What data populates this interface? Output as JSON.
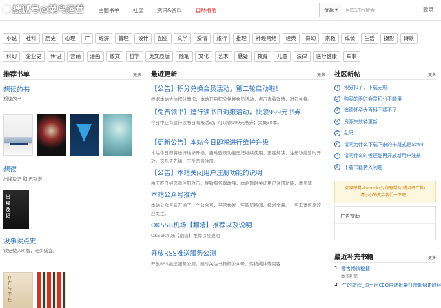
{
  "watermark": "搜狐号@菜鸟运营",
  "nav": {
    "items": [
      {
        "label": "主题书单",
        "active": false
      },
      {
        "label": "社区",
        "active": false
      },
      {
        "label": "资讯&资料",
        "active": false
      },
      {
        "label": "自助捐助",
        "active": true
      }
    ],
    "accent_color": "#d9302c"
  },
  "search": {
    "select_value": "资源",
    "placeholder": "回车进行搜索"
  },
  "login_label": "登录",
  "tags": [
    "小说",
    "社科",
    "历史",
    "心理",
    "IT",
    "经济",
    "管理",
    "设计",
    "创业",
    "文学",
    "爱情",
    "旅行",
    "推理",
    "神经网络",
    "经典",
    "奇幻",
    "宗教",
    "成长",
    "生活",
    "摄影",
    "诗歌",
    "科幻",
    "企业史",
    "传记",
    "营销",
    "漫画",
    "散文",
    "哲学",
    "英文原版",
    "随笔",
    "文化",
    "艺术",
    "悬疑",
    "教育",
    "儿童",
    "法律",
    "医疗健康",
    "军事"
  ],
  "recommend": {
    "title": "推荐书单",
    "more": "更多",
    "lists": [
      {
        "title": "想读的书",
        "desc": "想读的书"
      },
      {
        "title": "想读",
        "desc": "出埃及记 和 巴别塔"
      },
      {
        "title": "没事读点史",
        "desc": "读史使人明智，老少咸宜。"
      }
    ],
    "dark_cover_text": "出埃及记"
  },
  "latest": {
    "title": "最近更新",
    "more": "更多",
    "items": [
      {
        "title": "【公告】积分兑换会员活动，第二轮启动啦！",
        "body": "根据本站大体积分情况，本站开启积分兑换会员活动，点击查看详情，进行兑换。"
      },
      {
        "title": "【免费领书】建行读书日海报活动，快领999元书券",
        "body": "今日中亚有建行读书日海报活动，可以领999元书券；大概30本。"
      },
      {
        "title": "【更新公告】本站今日即将进行维护升级",
        "body": "本站今日即将进行维护升级，自动登录功能无法继续使用，正在解决，注册功能暂时开放，这几天先搞一下反恶意注册。"
      },
      {
        "title": "【公告】本站关闭用户注册功能的说明",
        "body": "由于昨日被恶意注册攻击，导致服务器故障，本站暂时关闭用户注册功能，请见谅"
      },
      {
        "title": "本站公众号推荐",
        "body": "本站公众号新开通了一个公众号，平常会发一些新见所闻、技术文章、一些丰富信息欢迎关注。"
      },
      {
        "title": "OKSSR机场【翻墙】推荐以及说明",
        "body": "OKSSR机场【翻墙】推荐以及说明"
      },
      {
        "title": "开放RSS推送服务公测",
        "body": "开放RSS推送服务公测，随时关注书籍和公众号，传统媒体等内容"
      }
    ]
  },
  "community": {
    "title": "社区新帖",
    "more": "更多",
    "posts": [
      {
        "num": "1",
        "title": "积分扣了，下载无影"
      },
      {
        "num": "2",
        "title": "购买的限时会员积分不能用"
      },
      {
        "num": "3",
        "title": "海德怀孕大百科下载不了"
      },
      {
        "num": "4",
        "title": "资源失效待更新"
      },
      {
        "num": "5",
        "title": "乱码"
      },
      {
        "num": "6",
        "title": "请问为什么下载下来的书籍式是azw4"
      },
      {
        "num": "7",
        "title": "请问什么时候还能再开放新用户注册"
      },
      {
        "num": "8",
        "title": "下载书籍拷入问题"
      }
    ],
    "promo_line1": "如果感觉skebooks对你有帮助(或点击广告)",
    "promo_line2": "请小小的支持我们一下吧！",
    "ad_title": "广告赞助"
  },
  "recent_books": {
    "title": "最近补充书籍",
    "more": "更多",
    "items": [
      {
        "num": "1",
        "title": "零售畅销秘籍",
        "meta": "本多利范"
      },
      {
        "num": "2",
        "title": "一生的旅程_迪士尼CEO自述批量打造超级IP的经营哲学",
        "meta": ""
      }
    ]
  },
  "covers": {
    "bottom_cover_text": "存在与不在"
  }
}
